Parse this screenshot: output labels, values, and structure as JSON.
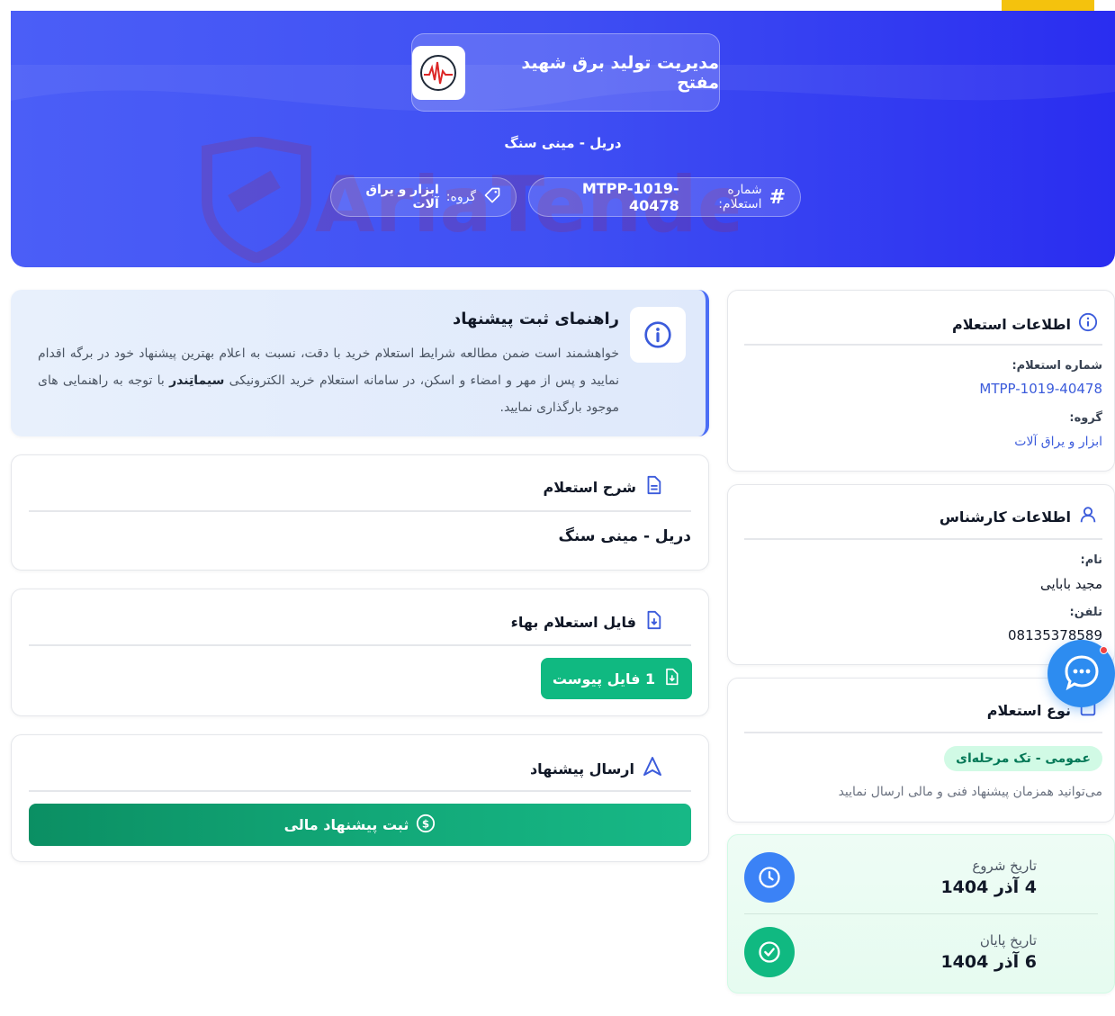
{
  "hero": {
    "org_name": "مدیریت تولید برق شهید مفتح",
    "subject": "دریل - مینی سنگ",
    "number_label": "شماره استعلام:",
    "number_value": "MTPP-1019-40478",
    "group_label": "گروه:",
    "group_value": "ابزار و یراق آلات",
    "watermark": "AriaTender.neT"
  },
  "guide": {
    "title": "راهنمای ثبت پیشنهاد",
    "text_part1": "خواهشمند است ضمن مطالعه شرایط استعلام خرید با دقت، نسبت به اعلام بهترین پیشنهاد خود در برگه اقدام نمایید و پس از مهر و امضاء و اسکن، در سامانه استعلام خرید الکترونیکی",
    "brand": "سیماتِندر",
    "text_part2": "با توجه به راهنمایی های موجود بارگذاری نمایید."
  },
  "description": {
    "title": "شرح استعلام",
    "text": "دریل - مینی سنگ"
  },
  "files": {
    "title": "فایل استعلام بهاء",
    "attach_button": "1 فایل پیوست"
  },
  "submit": {
    "title": "ارسال پیشنهاد",
    "button": "ثبت پیشنهاد مالی"
  },
  "inquiry_info": {
    "title": "اطلاعات استعلام",
    "number_label": "شماره استعلام:",
    "number_value": "MTPP-1019-40478",
    "group_label": "گروه:",
    "group_value": "ابزار و یراق آلات"
  },
  "expert": {
    "title": "اطلاعات کارشناس",
    "name_label": "نام:",
    "name_value": "مجید بابایی",
    "phone_label": "تلفن:",
    "phone_value": "08135378589"
  },
  "inquiry_type": {
    "title": "نوع استعلام",
    "badge": "عمومی - تک مرحله‌ای",
    "note": "می‌توانید همزمان پیشنهاد فنی و مالی ارسال نمایید"
  },
  "dates": {
    "start_label": "تاریخ شروع",
    "start_value": "4 آذر 1404",
    "end_label": "تاریخ پایان",
    "end_value": "6 آذر 1404"
  },
  "colors": {
    "primary": "#3f4ff3",
    "success": "#10b981",
    "link": "#3b5bdb",
    "chat": "#2d8cf0"
  }
}
